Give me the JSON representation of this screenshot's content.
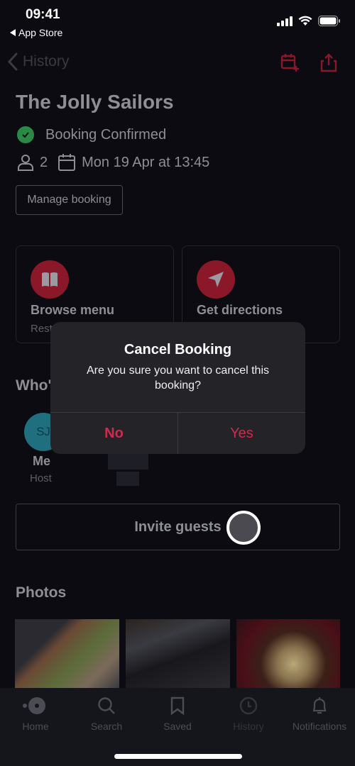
{
  "status_bar": {
    "time": "09:41",
    "back_app": "App Store",
    "icons": [
      "signal-icon",
      "wifi-icon",
      "battery-icon"
    ]
  },
  "nav": {
    "back_label": "History",
    "actions": [
      "add-to-calendar-icon",
      "share-icon"
    ],
    "accent_color": "#8a1828"
  },
  "booking": {
    "restaurant_name": "The Jolly Sailors",
    "status": "Booking Confirmed",
    "guests": "2",
    "datetime": "Mon 19 Apr at 13:45",
    "manage_label": "Manage booking"
  },
  "cards": [
    {
      "label": "Browse menu",
      "sub": "Rest",
      "icon": "book-icon"
    },
    {
      "label": "Get directions",
      "sub": "",
      "icon": "navigation-arrow-icon"
    }
  ],
  "whos_coming": {
    "title": "Who'",
    "guests": [
      {
        "initials": "SJ",
        "name": "Me",
        "role": "Host"
      }
    ]
  },
  "invite_label": "Invite guests",
  "photos": {
    "title": "Photos",
    "items": [
      "pizza-photo",
      "mussels-photo",
      "stew-photo"
    ]
  },
  "tab_bar": {
    "tabs": [
      {
        "label": "Home",
        "icon": "home-icon"
      },
      {
        "label": "Search",
        "icon": "search-icon"
      },
      {
        "label": "Saved",
        "icon": "bookmark-icon"
      },
      {
        "label": "History",
        "icon": "clock-icon"
      },
      {
        "label": "Notifications",
        "icon": "bell-icon"
      }
    ]
  },
  "modal": {
    "title": "Cancel Booking",
    "message": "Are you sure you want to cancel this booking?",
    "no_label": "No",
    "yes_label": "Yes",
    "button_color": "#d4284e"
  }
}
